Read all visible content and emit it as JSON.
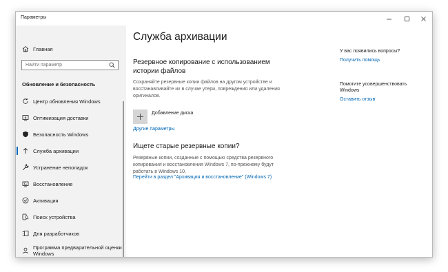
{
  "window": {
    "title": "Параметры"
  },
  "sidebar": {
    "home_label": "Главная",
    "search_placeholder": "Найти параметр",
    "section_title": "Обновление и безопасность",
    "items": [
      {
        "label": "Центр обновления Windows",
        "icon": "sync-icon"
      },
      {
        "label": "Оптимизация доставки",
        "icon": "delivery-icon"
      },
      {
        "label": "Безопасность Windows",
        "icon": "shield-icon"
      },
      {
        "label": "Служба архивации",
        "icon": "backup-arrow-icon",
        "active": true
      },
      {
        "label": "Устранение неполадок",
        "icon": "wrench-icon"
      },
      {
        "label": "Восстановление",
        "icon": "restore-icon"
      },
      {
        "label": "Активация",
        "icon": "check-circle-icon"
      },
      {
        "label": "Поиск устройства",
        "icon": "find-device-icon"
      },
      {
        "label": "Для разработчиков",
        "icon": "developer-icon"
      },
      {
        "label_line1": "Программа предварительной оценки",
        "label_line2": "Windows",
        "icon": "insider-icon"
      }
    ]
  },
  "main": {
    "title": "Служба архивации",
    "file_history": {
      "heading_line1": "Резервное копирование с использованием",
      "heading_line2": "истории файлов",
      "description_line1": "Сохраняйте резервные копии файлов на другом устройстве и",
      "description_line2": "восстанавливайте их в случае утери, повреждения или удаления",
      "description_line3": "оригиналов.",
      "add_disk_label": "Добавление диска",
      "more_options_link": "Другие параметры"
    },
    "old_backup": {
      "heading": "Ищете старые резервные копии?",
      "description_line1": "Резервные копии, созданные с помощью средства резервного",
      "description_line2": "копирования и восстановления Windows 7, по-прежнему будут",
      "description_line3": "работать в Windows 10.",
      "link": "Перейти в раздел \"Архивация и восстановление\" (Windows 7)"
    }
  },
  "aside": {
    "questions_text": "У вас появились вопросы?",
    "help_link": "Получить помощь",
    "improve_line1": "Помогите усовершенствовать",
    "improve_line2": "Windows",
    "feedback_link": "Оставить отзыв"
  },
  "colors": {
    "accent": "#0067c0",
    "link": "#0066b4",
    "sidebar_bg": "#f2f2f2"
  }
}
